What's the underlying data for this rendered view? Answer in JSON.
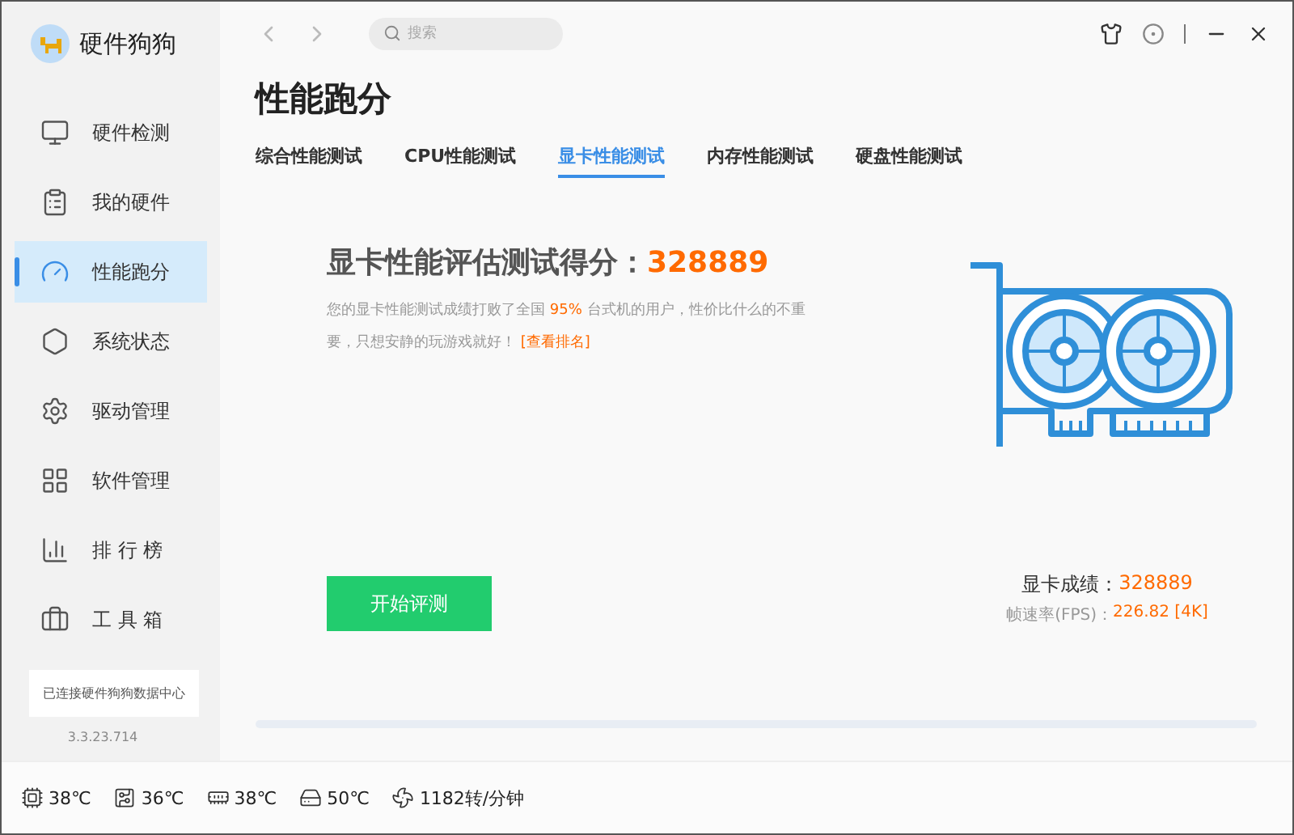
{
  "app": {
    "name": "硬件狗狗"
  },
  "search": {
    "placeholder": "搜索"
  },
  "sidebar": {
    "items": [
      {
        "label": "硬件检测",
        "kind": "monitor",
        "selected": false
      },
      {
        "label": "我的硬件",
        "kind": "list",
        "selected": false
      },
      {
        "label": "性能跑分",
        "kind": "gauge",
        "selected": true
      },
      {
        "label": "系统状态",
        "kind": "status",
        "selected": false
      },
      {
        "label": "驱动管理",
        "kind": "gear",
        "selected": false
      },
      {
        "label": "软件管理",
        "kind": "grid",
        "selected": false
      },
      {
        "label": "排 行 榜",
        "kind": "chart",
        "selected": false
      },
      {
        "label": "工 具 箱",
        "kind": "toolbox",
        "selected": false
      }
    ],
    "connection": "已连接硬件狗狗数据中心",
    "version": "3.3.23.714"
  },
  "page": {
    "title": "性能跑分",
    "tabs": [
      {
        "label": "综合性能测试",
        "selected": false
      },
      {
        "label": "CPU性能测试",
        "selected": false
      },
      {
        "label": "显卡性能测试",
        "selected": true
      },
      {
        "label": "内存性能测试",
        "selected": false
      },
      {
        "label": "硬盘性能测试",
        "selected": false
      }
    ],
    "score_label": "显卡性能评估测试得分：",
    "score": "328889",
    "description": [
      {
        "kind": "text",
        "text": "您的显卡性能测试成绩打败了全国 "
      },
      {
        "kind": "highlight",
        "text": "95%"
      },
      {
        "kind": "text",
        "text": " 台式机的用户，性价比什么的不重要，只想安静的玩游戏就好！ "
      },
      {
        "kind": "link",
        "text": "[查看排名]"
      }
    ],
    "start_button": "开始评测",
    "result_label": "显卡成绩：",
    "result_value": "328889",
    "fps_label": "帧速率(FPS)：",
    "fps_value": "226.82 [4K]",
    "progress": {
      "level": 0
    }
  },
  "status_bar": [
    {
      "kind": "cpu",
      "text": "38℃"
    },
    {
      "kind": "board",
      "text": "36℃"
    },
    {
      "kind": "gpu",
      "text": "38℃"
    },
    {
      "kind": "disk",
      "text": "50℃"
    },
    {
      "kind": "fan",
      "text": "1182转/分钟"
    }
  ]
}
